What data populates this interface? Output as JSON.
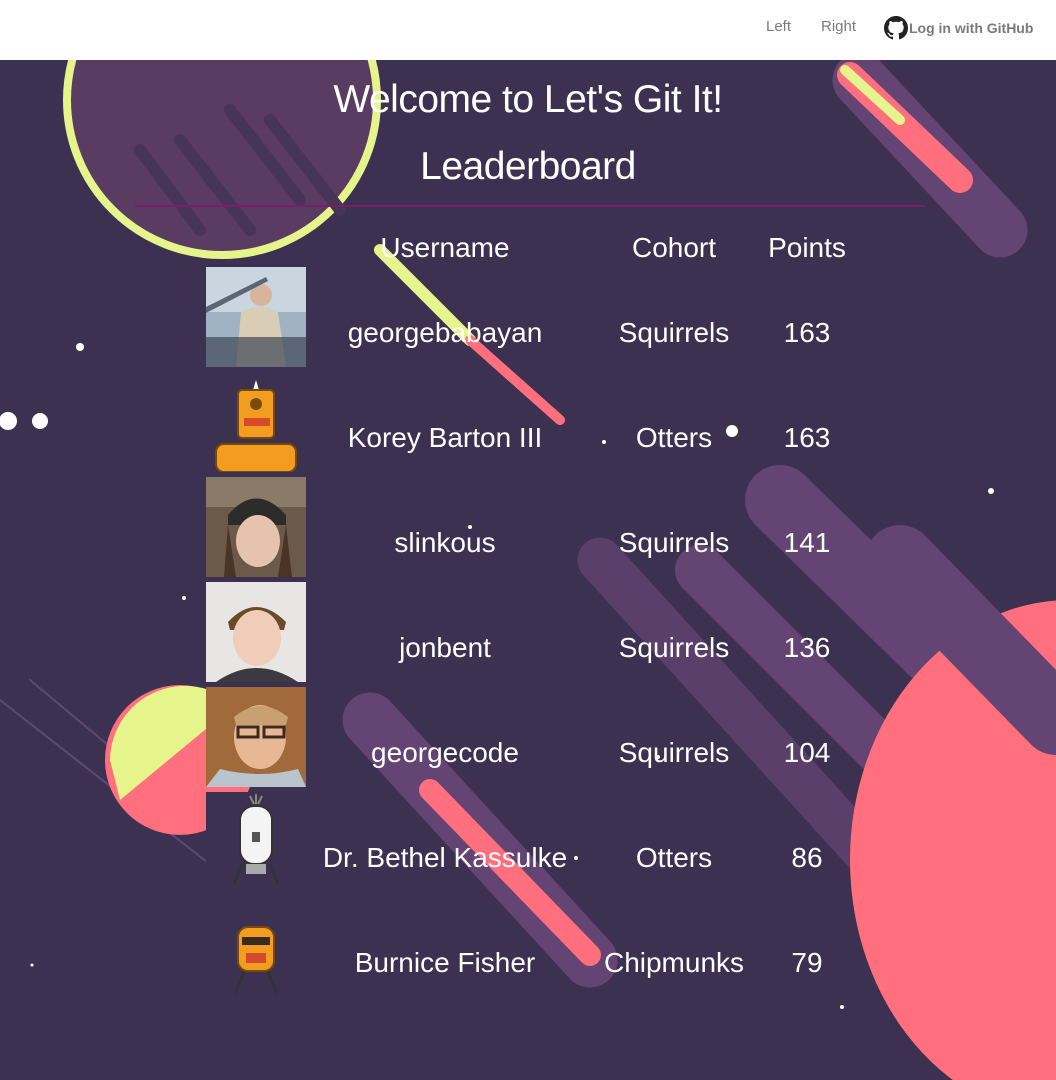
{
  "nav": {
    "left_label": "Left",
    "right_label": "Right",
    "login_label": "Log in with GitHub"
  },
  "main": {
    "title": "Welcome to Let's Git It!",
    "subtitle": "Leaderboard"
  },
  "table": {
    "headers": {
      "username": "Username",
      "cohort": "Cohort",
      "points": "Points"
    },
    "rows": [
      {
        "username": "georgebabayan",
        "cohort": "Squirrels",
        "points": "163",
        "avatar": "photo-man-boat"
      },
      {
        "username": "Korey Barton III",
        "cohort": "Otters",
        "points": "163",
        "avatar": "robot-orange"
      },
      {
        "username": "slinkous",
        "cohort": "Squirrels",
        "points": "141",
        "avatar": "photo-woman-beanie"
      },
      {
        "username": "jonbent",
        "cohort": "Squirrels",
        "points": "136",
        "avatar": "photo-young-man"
      },
      {
        "username": "georgecode",
        "cohort": "Squirrels",
        "points": "104",
        "avatar": "photo-man-glasses"
      },
      {
        "username": "Dr. Bethel Kassulke",
        "cohort": "Otters",
        "points": "86",
        "avatar": "robot-white"
      },
      {
        "username": "Burnice Fisher",
        "cohort": "Chipmunks",
        "points": "79",
        "avatar": "robot-orange-small"
      }
    ]
  },
  "colors": {
    "background": "#3d3151",
    "divider": "#7a1e6c",
    "planet_pink": "#ff6f7d",
    "ring_green": "#e6f48c",
    "streak_purple": "#634472"
  }
}
